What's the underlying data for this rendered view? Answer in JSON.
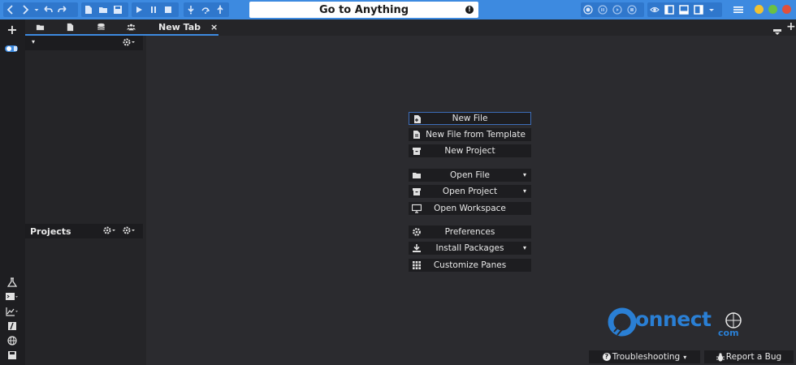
{
  "toolbar": {
    "goto_label": "Go to Anything",
    "goto_info": "!",
    "accent": "#3d8ae0"
  },
  "tabs": {
    "new_tab_label": "New Tab",
    "close_glyph": "×"
  },
  "sidebar": {
    "projects_label": "Projects"
  },
  "quick_actions": [
    {
      "label": "New File",
      "icon": "file-new-icon"
    },
    {
      "label": "New File from Template",
      "icon": "file-template-icon"
    },
    {
      "label": "New Project",
      "icon": "project-icon"
    },
    {
      "label": "Open File",
      "icon": "folder-open-icon"
    },
    {
      "label": "Open Project",
      "icon": "project-icon"
    },
    {
      "label": "Open Workspace",
      "icon": "monitor-icon"
    },
    {
      "label": "Preferences",
      "icon": "gear-icon"
    },
    {
      "label": "Install Packages",
      "icon": "download-icon"
    },
    {
      "label": "Customize Panes",
      "icon": "grid-icon"
    }
  ],
  "status": {
    "troubleshooting_label": "Troubleshooting",
    "report_bug_label": "Report a Bug"
  },
  "watermark": {
    "text": "onnect",
    "suffix": "com"
  }
}
